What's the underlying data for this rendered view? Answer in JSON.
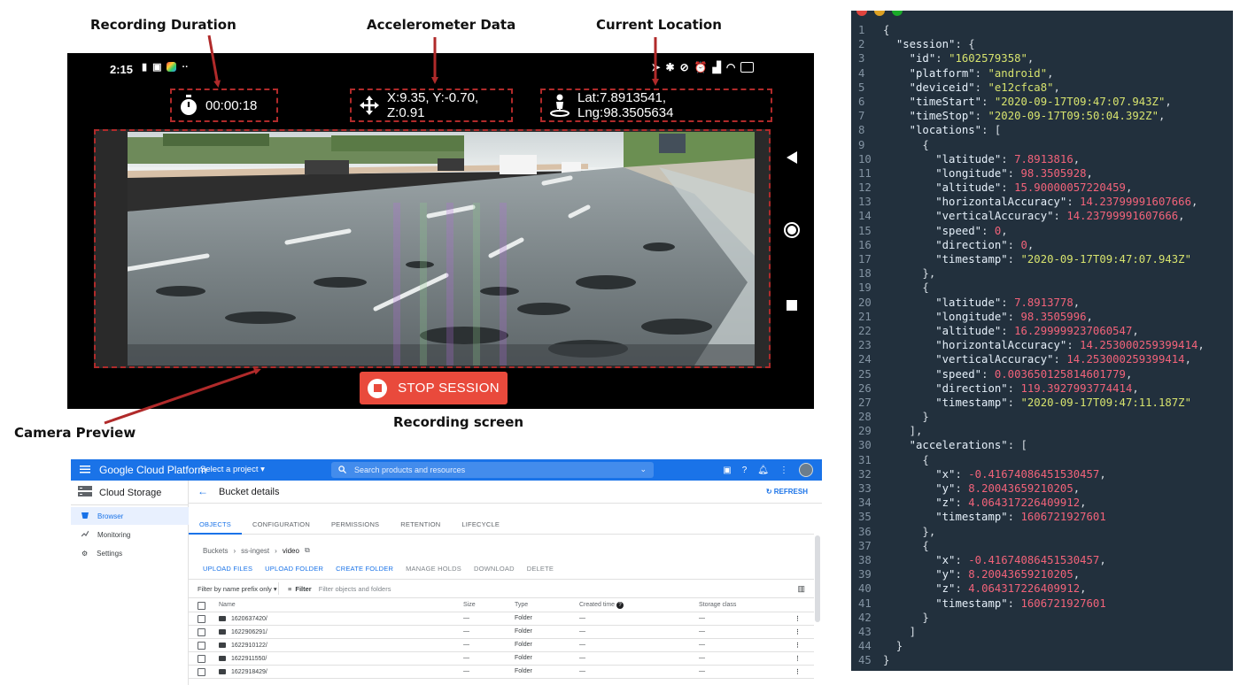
{
  "annotations": {
    "recording_duration": "Recording Duration",
    "accelerometer_data": "Accelerometer Data",
    "current_location": "Current Location",
    "camera_preview": "Camera Preview",
    "recording_screen": "Recording screen"
  },
  "colors": {
    "annotation_red": "#b02a2a",
    "stop_button": "#e94a3c",
    "gcp_blue": "#1a73e8",
    "code_bg": "#22303d",
    "code_string": "#d7e36e",
    "code_number": "#f2637a"
  },
  "phone": {
    "status_time": "2:15",
    "duration": "00:00:18",
    "accelerometer": "X:9.35, Y:-0.70, Z:0.91",
    "location": "Lat:7.8913541, Lng:98.3505634",
    "stop_label": "STOP SESSION",
    "icons": [
      "stopwatch-icon",
      "move-arrows-icon",
      "person-pin-icon",
      "back-triangle-icon",
      "home-circle-icon",
      "recents-square-icon"
    ]
  },
  "gcp": {
    "brand": "Google Cloud Platform",
    "project_select": "Select a project",
    "search_placeholder": "Search products and resources",
    "product": "Cloud Storage",
    "nav": [
      "Browser",
      "Monitoring",
      "Settings"
    ],
    "page_title": "Bucket details",
    "refresh": "REFRESH",
    "tabs": [
      "OBJECTS",
      "CONFIGURATION",
      "PERMISSIONS",
      "RETENTION",
      "LIFECYCLE"
    ],
    "breadcrumb": [
      "Buckets",
      "ss-ingest",
      "video"
    ],
    "actions": [
      "UPLOAD FILES",
      "UPLOAD FOLDER",
      "CREATE FOLDER",
      "MANAGE HOLDS",
      "DOWNLOAD",
      "DELETE"
    ],
    "filter_prefix": "Filter by name prefix only",
    "filter_label": "Filter",
    "filter_placeholder": "Filter objects and folders",
    "columns": [
      "Name",
      "Size",
      "Type",
      "Created time",
      "Storage class"
    ],
    "rows": [
      {
        "name": "1620637420/",
        "size": "—",
        "type": "Folder",
        "created": "—",
        "class": "—"
      },
      {
        "name": "1622906291/",
        "size": "—",
        "type": "Folder",
        "created": "—",
        "class": "—"
      },
      {
        "name": "1622910122/",
        "size": "—",
        "type": "Folder",
        "created": "—",
        "class": "—"
      },
      {
        "name": "1622911550/",
        "size": "—",
        "type": "Folder",
        "created": "—",
        "class": "—"
      },
      {
        "name": "1622918429/",
        "size": "—",
        "type": "Folder",
        "created": "—",
        "class": "—"
      }
    ]
  },
  "code": {
    "lines": [
      {
        "ln": "1",
        "t": [
          [
            "p",
            "{"
          ]
        ]
      },
      {
        "ln": "2",
        "t": [
          [
            "p",
            "  "
          ],
          [
            "k",
            "\"session\""
          ],
          [
            "p",
            ": {"
          ]
        ]
      },
      {
        "ln": "3",
        "t": [
          [
            "p",
            "    "
          ],
          [
            "k",
            "\"id\""
          ],
          [
            "p",
            ": "
          ],
          [
            "s",
            "\"1602579358\""
          ],
          [
            "p",
            ","
          ]
        ]
      },
      {
        "ln": "4",
        "t": [
          [
            "p",
            "    "
          ],
          [
            "k",
            "\"platform\""
          ],
          [
            "p",
            ": "
          ],
          [
            "s",
            "\"android\""
          ],
          [
            "p",
            ","
          ]
        ]
      },
      {
        "ln": "5",
        "t": [
          [
            "p",
            "    "
          ],
          [
            "k",
            "\"deviceid\""
          ],
          [
            "p",
            ": "
          ],
          [
            "s",
            "\"e12cfca8\""
          ],
          [
            "p",
            ","
          ]
        ]
      },
      {
        "ln": "6",
        "t": [
          [
            "p",
            "    "
          ],
          [
            "k",
            "\"timeStart\""
          ],
          [
            "p",
            ": "
          ],
          [
            "s",
            "\"2020-09-17T09:47:07.943Z\""
          ],
          [
            "p",
            ","
          ]
        ]
      },
      {
        "ln": "7",
        "t": [
          [
            "p",
            "    "
          ],
          [
            "k",
            "\"timeStop\""
          ],
          [
            "p",
            ": "
          ],
          [
            "s",
            "\"2020-09-17T09:50:04.392Z\""
          ],
          [
            "p",
            ","
          ]
        ]
      },
      {
        "ln": "8",
        "t": [
          [
            "p",
            "    "
          ],
          [
            "k",
            "\"locations\""
          ],
          [
            "p",
            ": ["
          ]
        ]
      },
      {
        "ln": "9",
        "t": [
          [
            "p",
            "      {"
          ]
        ]
      },
      {
        "ln": "10",
        "t": [
          [
            "p",
            "        "
          ],
          [
            "k",
            "\"latitude\""
          ],
          [
            "p",
            ": "
          ],
          [
            "n",
            "7.8913816"
          ],
          [
            "p",
            ","
          ]
        ]
      },
      {
        "ln": "11",
        "t": [
          [
            "p",
            "        "
          ],
          [
            "k",
            "\"longitude\""
          ],
          [
            "p",
            ": "
          ],
          [
            "n",
            "98.3505928"
          ],
          [
            "p",
            ","
          ]
        ]
      },
      {
        "ln": "12",
        "t": [
          [
            "p",
            "        "
          ],
          [
            "k",
            "\"altitude\""
          ],
          [
            "p",
            ": "
          ],
          [
            "n",
            "15.90000057220459"
          ],
          [
            "p",
            ","
          ]
        ]
      },
      {
        "ln": "13",
        "t": [
          [
            "p",
            "        "
          ],
          [
            "k",
            "\"horizontalAccuracy\""
          ],
          [
            "p",
            ": "
          ],
          [
            "n",
            "14.23799991607666"
          ],
          [
            "p",
            ","
          ]
        ]
      },
      {
        "ln": "14",
        "t": [
          [
            "p",
            "        "
          ],
          [
            "k",
            "\"verticalAccuracy\""
          ],
          [
            "p",
            ": "
          ],
          [
            "n",
            "14.23799991607666"
          ],
          [
            "p",
            ","
          ]
        ]
      },
      {
        "ln": "15",
        "t": [
          [
            "p",
            "        "
          ],
          [
            "k",
            "\"speed\""
          ],
          [
            "p",
            ": "
          ],
          [
            "n",
            "0"
          ],
          [
            "p",
            ","
          ]
        ]
      },
      {
        "ln": "16",
        "t": [
          [
            "p",
            "        "
          ],
          [
            "k",
            "\"direction\""
          ],
          [
            "p",
            ": "
          ],
          [
            "n",
            "0"
          ],
          [
            "p",
            ","
          ]
        ]
      },
      {
        "ln": "17",
        "t": [
          [
            "p",
            "        "
          ],
          [
            "k",
            "\"timestamp\""
          ],
          [
            "p",
            ": "
          ],
          [
            "s",
            "\"2020-09-17T09:47:07.943Z\""
          ]
        ]
      },
      {
        "ln": "18",
        "t": [
          [
            "p",
            "      },"
          ]
        ]
      },
      {
        "ln": "19",
        "t": [
          [
            "p",
            "      {"
          ]
        ]
      },
      {
        "ln": "20",
        "t": [
          [
            "p",
            "        "
          ],
          [
            "k",
            "\"latitude\""
          ],
          [
            "p",
            ": "
          ],
          [
            "n",
            "7.8913778"
          ],
          [
            "p",
            ","
          ]
        ]
      },
      {
        "ln": "21",
        "t": [
          [
            "p",
            "        "
          ],
          [
            "k",
            "\"longitude\""
          ],
          [
            "p",
            ": "
          ],
          [
            "n",
            "98.3505996"
          ],
          [
            "p",
            ","
          ]
        ]
      },
      {
        "ln": "22",
        "t": [
          [
            "p",
            "        "
          ],
          [
            "k",
            "\"altitude\""
          ],
          [
            "p",
            ": "
          ],
          [
            "n",
            "16.299999237060547"
          ],
          [
            "p",
            ","
          ]
        ]
      },
      {
        "ln": "23",
        "t": [
          [
            "p",
            "        "
          ],
          [
            "k",
            "\"horizontalAccuracy\""
          ],
          [
            "p",
            ": "
          ],
          [
            "n",
            "14.253000259399414"
          ],
          [
            "p",
            ","
          ]
        ]
      },
      {
        "ln": "24",
        "t": [
          [
            "p",
            "        "
          ],
          [
            "k",
            "\"verticalAccuracy\""
          ],
          [
            "p",
            ": "
          ],
          [
            "n",
            "14.253000259399414"
          ],
          [
            "p",
            ","
          ]
        ]
      },
      {
        "ln": "25",
        "t": [
          [
            "p",
            "        "
          ],
          [
            "k",
            "\"speed\""
          ],
          [
            "p",
            ": "
          ],
          [
            "n",
            "0.003650125814601779"
          ],
          [
            "p",
            ","
          ]
        ]
      },
      {
        "ln": "26",
        "t": [
          [
            "p",
            "        "
          ],
          [
            "k",
            "\"direction\""
          ],
          [
            "p",
            ": "
          ],
          [
            "n",
            "119.3927993774414"
          ],
          [
            "p",
            ","
          ]
        ]
      },
      {
        "ln": "27",
        "t": [
          [
            "p",
            "        "
          ],
          [
            "k",
            "\"timestamp\""
          ],
          [
            "p",
            ": "
          ],
          [
            "s",
            "\"2020-09-17T09:47:11.187Z\""
          ]
        ]
      },
      {
        "ln": "28",
        "t": [
          [
            "p",
            "      }"
          ]
        ]
      },
      {
        "ln": "29",
        "t": [
          [
            "p",
            "    ],"
          ]
        ]
      },
      {
        "ln": "30",
        "t": [
          [
            "p",
            "    "
          ],
          [
            "k",
            "\"accelerations\""
          ],
          [
            "p",
            ": ["
          ]
        ]
      },
      {
        "ln": "31",
        "t": [
          [
            "p",
            "      {"
          ]
        ]
      },
      {
        "ln": "32",
        "t": [
          [
            "p",
            "        "
          ],
          [
            "k",
            "\"x\""
          ],
          [
            "p",
            ": "
          ],
          [
            "n",
            "-0.41674086451530457"
          ],
          [
            "p",
            ","
          ]
        ]
      },
      {
        "ln": "33",
        "t": [
          [
            "p",
            "        "
          ],
          [
            "k",
            "\"y\""
          ],
          [
            "p",
            ": "
          ],
          [
            "n",
            "8.20043659210205"
          ],
          [
            "p",
            ","
          ]
        ]
      },
      {
        "ln": "34",
        "t": [
          [
            "p",
            "        "
          ],
          [
            "k",
            "\"z\""
          ],
          [
            "p",
            ": "
          ],
          [
            "n",
            "4.064317226409912"
          ],
          [
            "p",
            ","
          ]
        ]
      },
      {
        "ln": "35",
        "t": [
          [
            "p",
            "        "
          ],
          [
            "k",
            "\"timestamp\""
          ],
          [
            "p",
            ": "
          ],
          [
            "n",
            "1606721927601"
          ]
        ]
      },
      {
        "ln": "36",
        "t": [
          [
            "p",
            "      },"
          ]
        ]
      },
      {
        "ln": "37",
        "t": [
          [
            "p",
            "      {"
          ]
        ]
      },
      {
        "ln": "38",
        "t": [
          [
            "p",
            "        "
          ],
          [
            "k",
            "\"x\""
          ],
          [
            "p",
            ": "
          ],
          [
            "n",
            "-0.41674086451530457"
          ],
          [
            "p",
            ","
          ]
        ]
      },
      {
        "ln": "39",
        "t": [
          [
            "p",
            "        "
          ],
          [
            "k",
            "\"y\""
          ],
          [
            "p",
            ": "
          ],
          [
            "n",
            "8.20043659210205"
          ],
          [
            "p",
            ","
          ]
        ]
      },
      {
        "ln": "40",
        "t": [
          [
            "p",
            "        "
          ],
          [
            "k",
            "\"z\""
          ],
          [
            "p",
            ": "
          ],
          [
            "n",
            "4.064317226409912"
          ],
          [
            "p",
            ","
          ]
        ]
      },
      {
        "ln": "41",
        "t": [
          [
            "p",
            "        "
          ],
          [
            "k",
            "\"timestamp\""
          ],
          [
            "p",
            ": "
          ],
          [
            "n",
            "1606721927601"
          ]
        ]
      },
      {
        "ln": "42",
        "t": [
          [
            "p",
            "      }"
          ]
        ]
      },
      {
        "ln": "43",
        "t": [
          [
            "p",
            "    ]"
          ]
        ]
      },
      {
        "ln": "44",
        "t": [
          [
            "p",
            "  }"
          ]
        ]
      },
      {
        "ln": "45",
        "t": [
          [
            "p",
            "}"
          ]
        ]
      }
    ]
  }
}
